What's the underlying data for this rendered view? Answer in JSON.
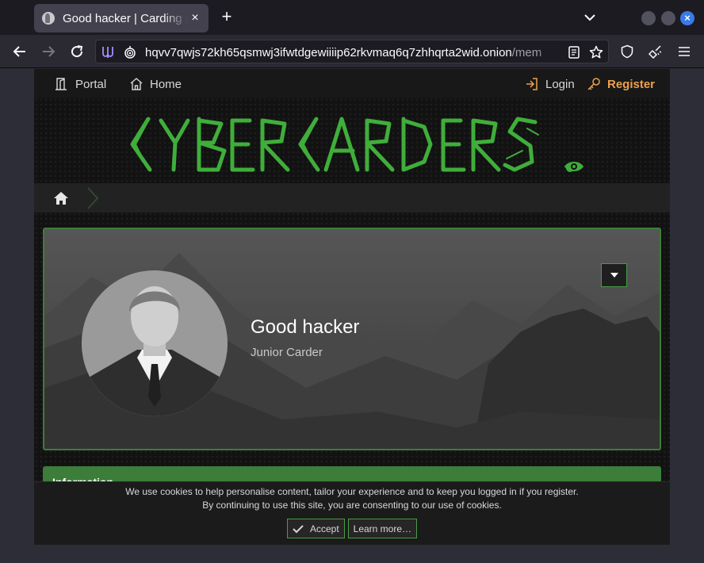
{
  "browser": {
    "tab_title": "Good hacker | Carding Fo",
    "tab_close": "×",
    "new_tab": "+",
    "window_close": "×",
    "url_main": "hqvv7qwjs72kh65qsmwj3ifwtdgewiiiip62rkvmaq6q7zhhqrta2wid.onion",
    "url_rest": "/mem"
  },
  "site": {
    "nav": {
      "portal": "Portal",
      "home": "Home",
      "login": "Login",
      "register": "Register"
    },
    "logo_alt": "CYBERCARDERS",
    "profile": {
      "username": "Good hacker",
      "user_title": "Junior Carder"
    },
    "info_heading": "Information",
    "cookie": {
      "line1": "We use cookies to help personalise content, tailor your experience and to keep you logged in if you register.",
      "line2": "By continuing to use this site, you are consenting to our use of cookies.",
      "accept": "Accept",
      "learn_more": "Learn more…"
    }
  },
  "colors": {
    "accent_green": "#3c7d3a",
    "logo_green": "#3fae3a",
    "register_orange": "#f0a04b",
    "browser_bg": "#2b2a33"
  }
}
